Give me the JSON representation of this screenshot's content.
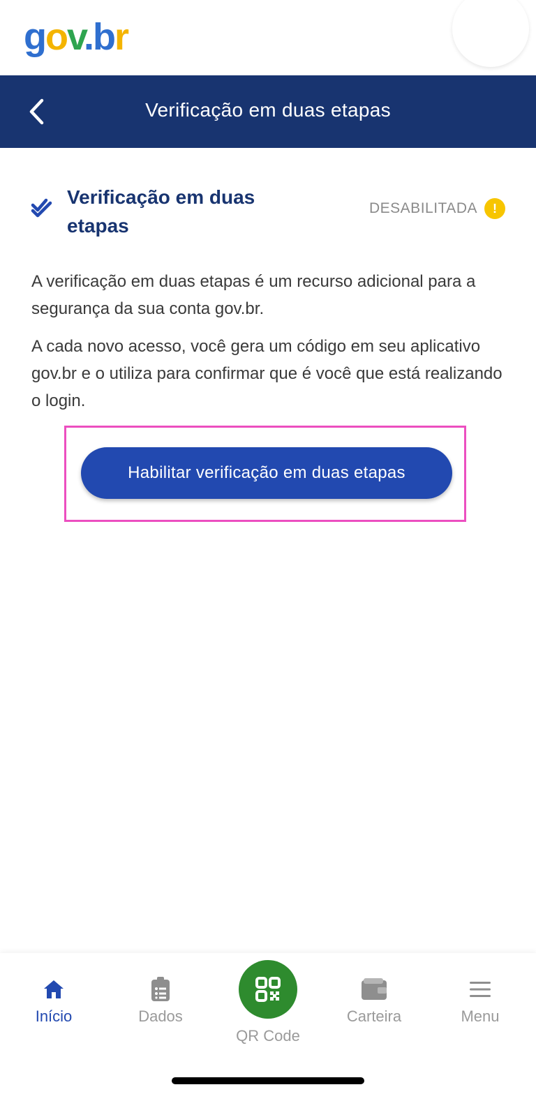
{
  "logo": {
    "g": "g",
    "o": "o",
    "v": "v",
    "dot": ".",
    "b": "b",
    "r": "r"
  },
  "header": {
    "title": "Verificação em duas etapas"
  },
  "section": {
    "title": "Verificação em duas etapas",
    "status": "DESABILITADA",
    "warn_symbol": "!"
  },
  "description": {
    "p1": "A verificação em duas etapas é um recurso adicional para a segurança da sua conta gov.br.",
    "p2": "A cada novo acesso, você gera um código em seu aplicativo gov.br e o utiliza para confirmar que é você que está realizando o login."
  },
  "action": {
    "button_label": "Habilitar verificação em duas etapas"
  },
  "nav": {
    "items": [
      {
        "label": "Início",
        "icon": "home-icon",
        "active": true
      },
      {
        "label": "Dados",
        "icon": "clipboard-icon",
        "active": false
      },
      {
        "label": "QR Code",
        "icon": "qr-code-icon",
        "active": false
      },
      {
        "label": "Carteira",
        "icon": "wallet-icon",
        "active": false
      },
      {
        "label": "Menu",
        "icon": "menu-icon",
        "active": false
      }
    ]
  },
  "colors": {
    "primary": "#2249b0",
    "title_bar": "#183470",
    "warning": "#f7c500",
    "qr_green": "#2e8b2e",
    "highlight": "#ec4fc0"
  }
}
